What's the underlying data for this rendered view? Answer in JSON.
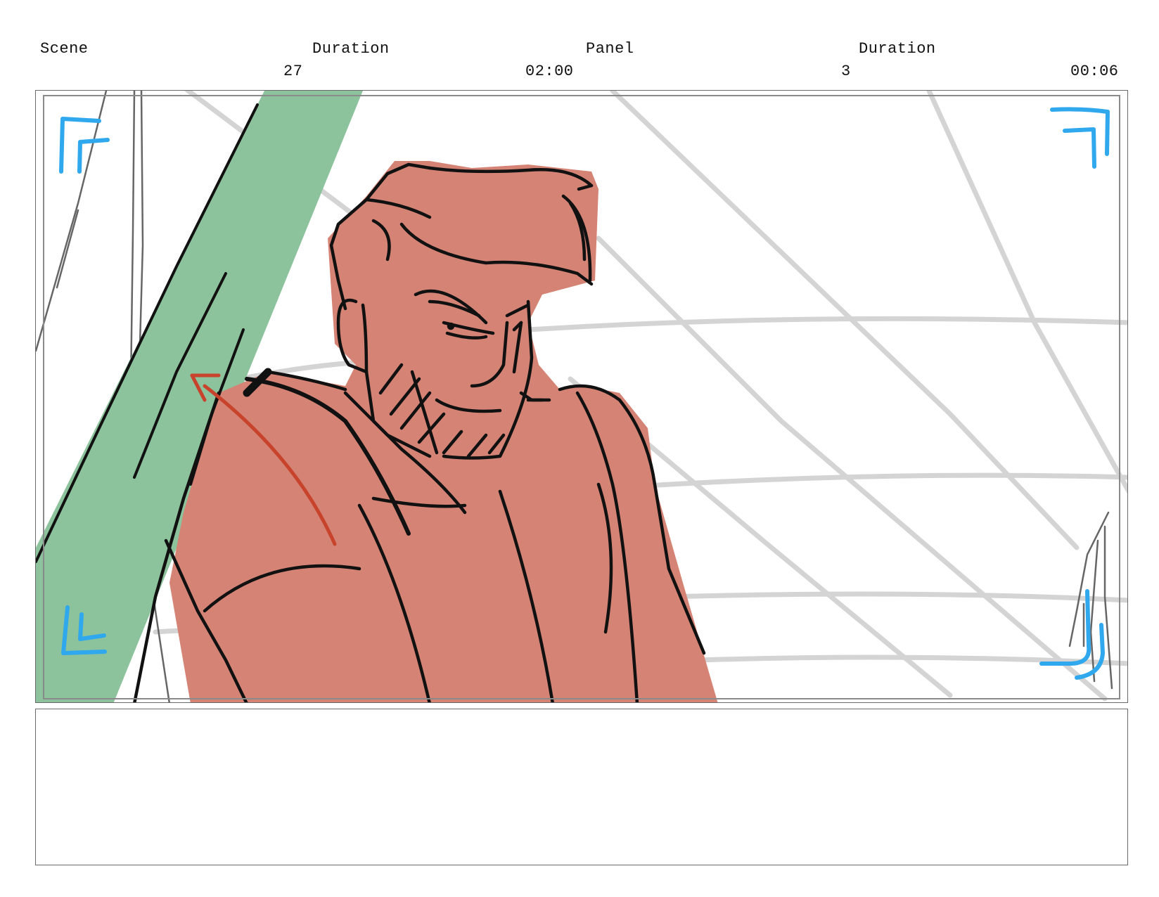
{
  "header": {
    "scene_label": "Scene",
    "duration_label": "Duration",
    "panel_label": "Panel",
    "panel_duration_label": "Duration",
    "scene_value": "27",
    "scene_duration_value": "02:00",
    "panel_value": "3",
    "panel_duration_value": "00:06"
  },
  "notes": {
    "text": ""
  },
  "colors": {
    "skin": "#d58375",
    "pillar": "#8dc39c",
    "frame_marks": "#2fa8ee",
    "arrow": "#c8432b",
    "background_lines": "#d4d4d4"
  }
}
